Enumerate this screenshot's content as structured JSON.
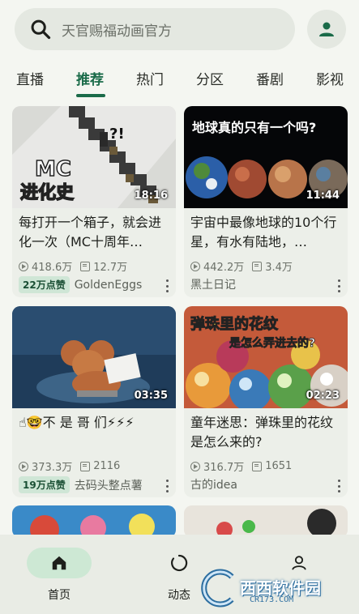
{
  "search": {
    "placeholder": "天官赐福动画官方"
  },
  "tabs": [
    "直播",
    "推荐",
    "热门",
    "分区",
    "番剧",
    "影视"
  ],
  "active_tab": "推荐",
  "cards": [
    {
      "thumb_text": "MC\n进化史",
      "thumb_badge": "?!",
      "duration": "18:16",
      "title": "每打开一个箱子，就会进化一次（MC十周年…",
      "views": "418.6万",
      "danmaku": "12.7万",
      "badge": "22万点赞",
      "author": "GoldenEggs"
    },
    {
      "thumb_text": "地球真的只有一个吗?",
      "duration": "11:44",
      "title": "宇宙中最像地球的10个行星，有水有陆地，…",
      "views": "442.2万",
      "danmaku": "3.4万",
      "badge": "",
      "author": "黑土日记"
    },
    {
      "duration": "03:35",
      "title": "☝🤓不 是 哥 们⚡⚡⚡",
      "views": "373.3万",
      "danmaku": "2116",
      "badge": "19万点赞",
      "author": "去码头整点薯"
    },
    {
      "thumb_text": "弹珠里的花纹",
      "thumb_text2": "是怎么弄进去的?",
      "duration": "02:23",
      "title": "童年迷思：弹珠里的花纹是怎么来的?",
      "views": "316.7万",
      "danmaku": "1651",
      "badge": "",
      "author": "古的idea"
    }
  ],
  "bottom_nav": [
    {
      "label": "首页",
      "icon": "home-icon"
    },
    {
      "label": "动态",
      "icon": "activity-icon"
    },
    {
      "label": "",
      "icon": "profile-icon"
    }
  ],
  "watermark": {
    "title": "西西软件园",
    "sub": "CR173.COM"
  },
  "colors": {
    "accent": "#1a6b49",
    "background": "#f4f6f1",
    "card": "#ecefe9"
  }
}
